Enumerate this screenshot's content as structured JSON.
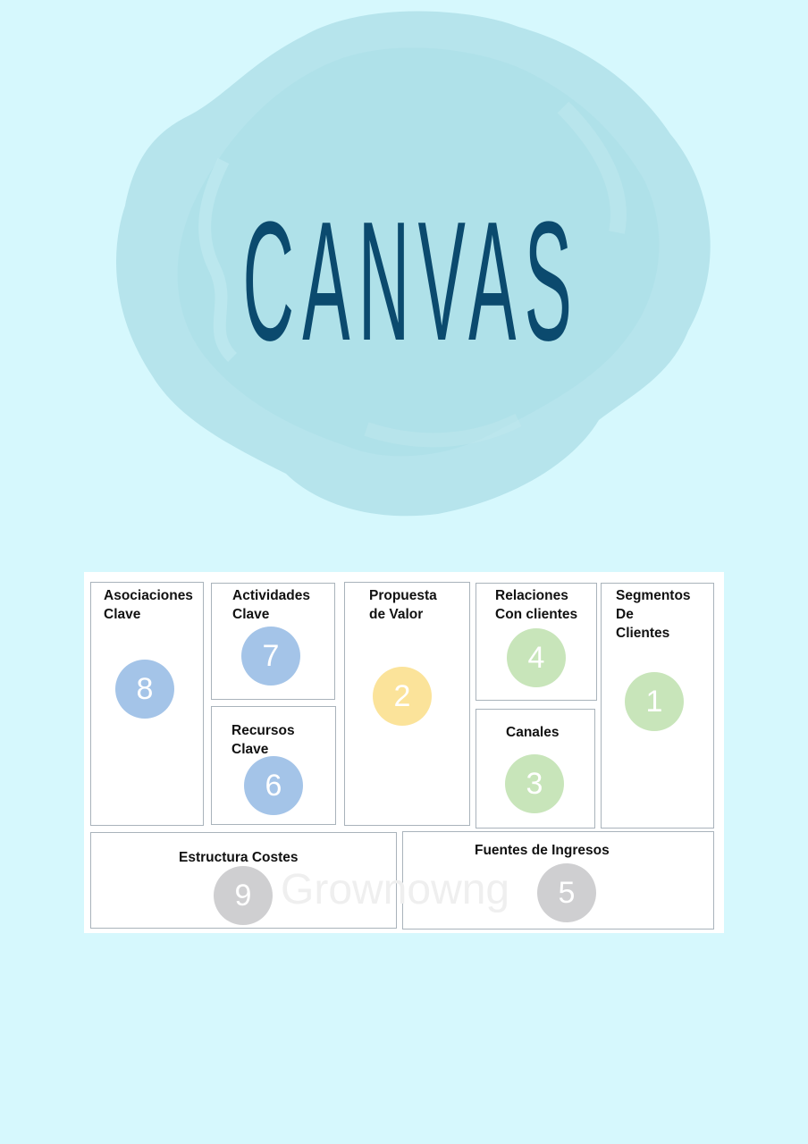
{
  "title": "CANVAS",
  "watermark": "Grownowng",
  "blocks": [
    {
      "label": "Asociaciones\nClave",
      "number": "8"
    },
    {
      "label": "Actividades\nClave",
      "number": "7"
    },
    {
      "label": "Recursos\nClave",
      "number": "6"
    },
    {
      "label": "Propuesta\nde Valor",
      "number": "2"
    },
    {
      "label": "Relaciones\nCon clientes",
      "number": "4"
    },
    {
      "label": "Canales",
      "number": "3"
    },
    {
      "label": "Segmentos\nDe\nClientes",
      "number": "1"
    },
    {
      "label": "Estructura Costes",
      "number": "9"
    },
    {
      "label": "Fuentes de Ingresos",
      "number": "5"
    }
  ],
  "colors": {
    "background": "#d6f8fd",
    "title": "#0b4a6e",
    "circle_blue": "#a4c4e8",
    "circle_yellow": "#fbe39a",
    "circle_green": "#c8e5ba",
    "circle_grey": "#cfcfd1"
  }
}
